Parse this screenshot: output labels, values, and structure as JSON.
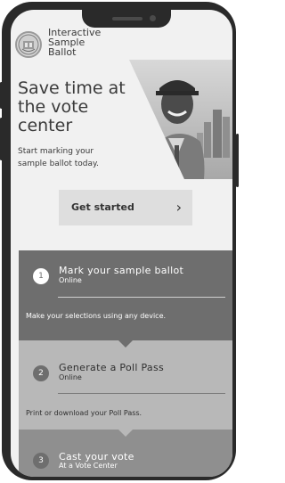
{
  "app": {
    "title": "Interactive\nSample\nBallot"
  },
  "hero": {
    "title": "Save time at\nthe vote\ncenter",
    "subtitle": "Start marking your sample ballot today.",
    "cta_label": "Get started",
    "cta_arrow": "›"
  },
  "steps": [
    {
      "number": "1",
      "title": "Mark your sample ballot",
      "subtitle": "Online",
      "description": "Make your selections using any device."
    },
    {
      "number": "2",
      "title": "Generate a Poll Pass",
      "subtitle": "Online",
      "description": "Print or download your Poll Pass."
    },
    {
      "number": "3",
      "title": "Cast your vote",
      "subtitle": "At a Vote Center",
      "description": ""
    }
  ],
  "colors": {
    "step1_bg": "#6e6e6e",
    "step2_bg": "#b8b8b8",
    "step3_bg": "#8f8f8f"
  }
}
